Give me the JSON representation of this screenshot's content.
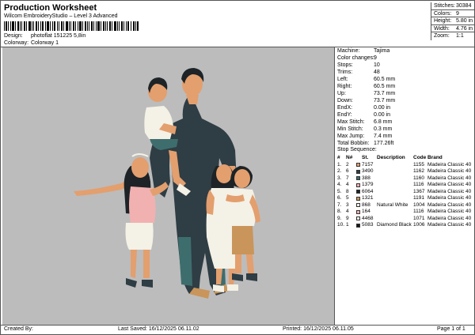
{
  "header": {
    "title": "Production Worksheet",
    "subtitle": "Wilcom EmbroideryStudio – Level 3 Advanced",
    "design_label": "Design:",
    "design_value": "photoflat 151225 5,8in",
    "colorway_label": "Colorway:",
    "colorway_value": "Colorway 1"
  },
  "stats": [
    {
      "label": "Stitches:",
      "value": "30384"
    },
    {
      "label": "Colors:",
      "value": "9"
    },
    {
      "label": "Height:",
      "value": "5.80 in"
    },
    {
      "label": "Width:",
      "value": "4.76 in"
    },
    {
      "label": "Zoom:",
      "value": "1:1"
    }
  ],
  "machine": [
    {
      "label": "Machine:",
      "value": "Tajima"
    },
    {
      "label": "Color changes:",
      "value": "9"
    },
    {
      "label": "Stops:",
      "value": "10"
    },
    {
      "label": "Trims:",
      "value": "48"
    },
    {
      "label": "Left:",
      "value": "60.5 mm"
    },
    {
      "label": "Right:",
      "value": "60.5 mm"
    },
    {
      "label": "Up:",
      "value": "73.7 mm"
    },
    {
      "label": "Down:",
      "value": "73.7 mm"
    },
    {
      "label": "EndX:",
      "value": "0.00 in"
    },
    {
      "label": "EndY:",
      "value": "0.00 in"
    },
    {
      "label": "Max Stitch:",
      "value": "6.8 mm"
    },
    {
      "label": "Min Stitch:",
      "value": "0.3 mm"
    },
    {
      "label": "Max Jump:",
      "value": "7.4 mm"
    },
    {
      "label": "Total Bobbin:",
      "value": "177.26ft"
    }
  ],
  "stop_sequence": {
    "title": "Stop Sequence:",
    "headers": {
      "n": "#",
      "num": "N#",
      "st": "St.",
      "desc": "Description",
      "code": "Code",
      "brand": "Brand"
    },
    "rows": [
      {
        "n": "1.",
        "num": "2",
        "color": "#e39f6e",
        "st": "7157",
        "desc": "",
        "code": "1155",
        "brand": "Madeira Classic 40"
      },
      {
        "n": "2.",
        "num": "6",
        "color": "#2f3d44",
        "st": "3490",
        "desc": "",
        "code": "1162",
        "brand": "Madeira Classic 40"
      },
      {
        "n": "3.",
        "num": "7",
        "color": "#3e6d6d",
        "st": "388",
        "desc": "",
        "code": "1160",
        "brand": "Madeira Classic 40"
      },
      {
        "n": "4.",
        "num": "4",
        "color": "#f1b1b1",
        "st": "1379",
        "desc": "",
        "code": "1116",
        "brand": "Madeira Classic 40"
      },
      {
        "n": "5.",
        "num": "8",
        "color": "#1d2326",
        "st": "6064",
        "desc": "",
        "code": "1367",
        "brand": "Madeira Classic 40"
      },
      {
        "n": "6.",
        "num": "5",
        "color": "#c9955a",
        "st": "1321",
        "desc": "",
        "code": "1191",
        "brand": "Madeira Classic 40"
      },
      {
        "n": "7.",
        "num": "3",
        "color": "#f4f1e6",
        "st": "868",
        "desc": "Natural White",
        "code": "1004",
        "brand": "Madeira Classic 40"
      },
      {
        "n": "8.",
        "num": "4",
        "color": "#f1b1b1",
        "st": "164",
        "desc": "",
        "code": "1116",
        "brand": "Madeira Classic 40"
      },
      {
        "n": "9.",
        "num": "9",
        "color": "#f7f3ec",
        "st": "4468",
        "desc": "",
        "code": "1071",
        "brand": "Madeira Classic 40"
      },
      {
        "n": "10.",
        "num": "1",
        "color": "#15181b",
        "st": "5083",
        "desc": "Diamond Black",
        "code": "1006",
        "brand": "Madeira Classic 40"
      }
    ]
  },
  "footer": {
    "created_by": "Created By:",
    "last_saved": "Last Saved: 16/12/2025 06.11.02",
    "printed": "Printed: 16/12/2025 06.11.05",
    "page": "Page 1 of 1"
  },
  "colors": {
    "preview_bg": "#bcbcbc",
    "skin": "#e39f6e",
    "dark_teal": "#2f3d44",
    "teal": "#3e6d6d",
    "pink": "#f1b1b1",
    "hair_black": "#1d2326",
    "khaki": "#c9955a",
    "white": "#f4f1e6"
  }
}
